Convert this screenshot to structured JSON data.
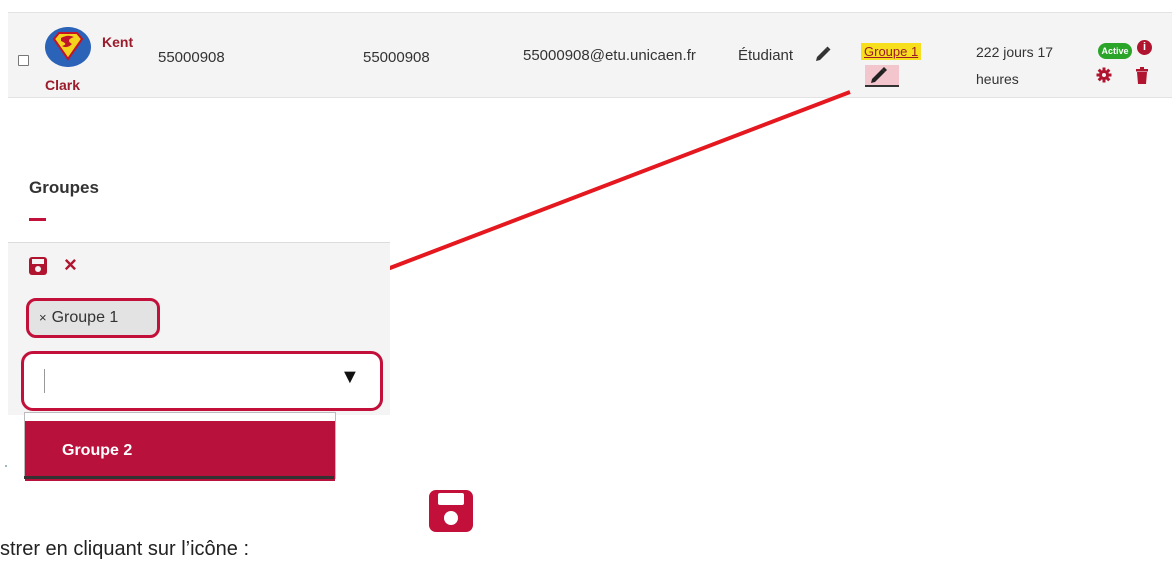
{
  "user_row": {
    "first_name": "Kent",
    "last_name": "Clark",
    "student_number": "55000908",
    "login": "55000908",
    "email": "55000908@etu.unicaen.fr",
    "role": "Étudiant",
    "group_tag": "Groupe 1",
    "time_left": "222 jours 17 heures",
    "status_badge": "Active",
    "avatar_icon": "superman-avatar-icon",
    "colors": {
      "accent": "#b0142f",
      "badge": "#2aa52a",
      "group_highlight": "#f7df1e"
    }
  },
  "groups_editor": {
    "title": "Groupes",
    "selected_chip": "Groupe 1",
    "chip_remove_symbol": "×",
    "cancel_symbol": "×",
    "select_arrow_symbol": "▼",
    "dropdown_options": [
      "Groupe 2"
    ]
  },
  "instruction": {
    "text": "strer en cliquant sur l’icône :"
  }
}
